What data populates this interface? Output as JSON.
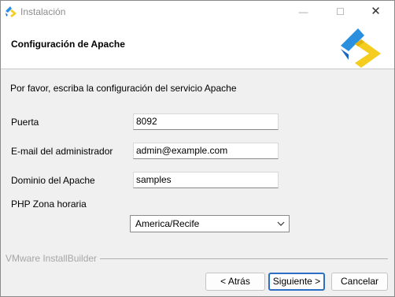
{
  "window": {
    "title": "Instalación",
    "controls": {
      "minimize": "—",
      "maximize": "☐",
      "close": "✕"
    }
  },
  "header": {
    "title": "Configuración de Apache"
  },
  "form": {
    "intro": "Por favor, escriba la configuración del servicio Apache",
    "port": {
      "label": "Puerta",
      "value": "8092"
    },
    "admin_email": {
      "label": "E-mail del administrador",
      "value": "admin@example.com"
    },
    "domain": {
      "label": "Dominio del Apache",
      "value": "samples"
    },
    "timezone": {
      "label": "PHP Zona horaria",
      "selected": "America/Recife"
    }
  },
  "footer": {
    "brand": "VMware InstallBuilder",
    "back_label": "< Atrás",
    "next_label": "Siguiente >",
    "cancel_label": "Cancelar"
  },
  "colors": {
    "accent": "#2d6fc4",
    "logo_blue": "#2b8fe0",
    "logo_yellow": "#f4cd1e"
  }
}
